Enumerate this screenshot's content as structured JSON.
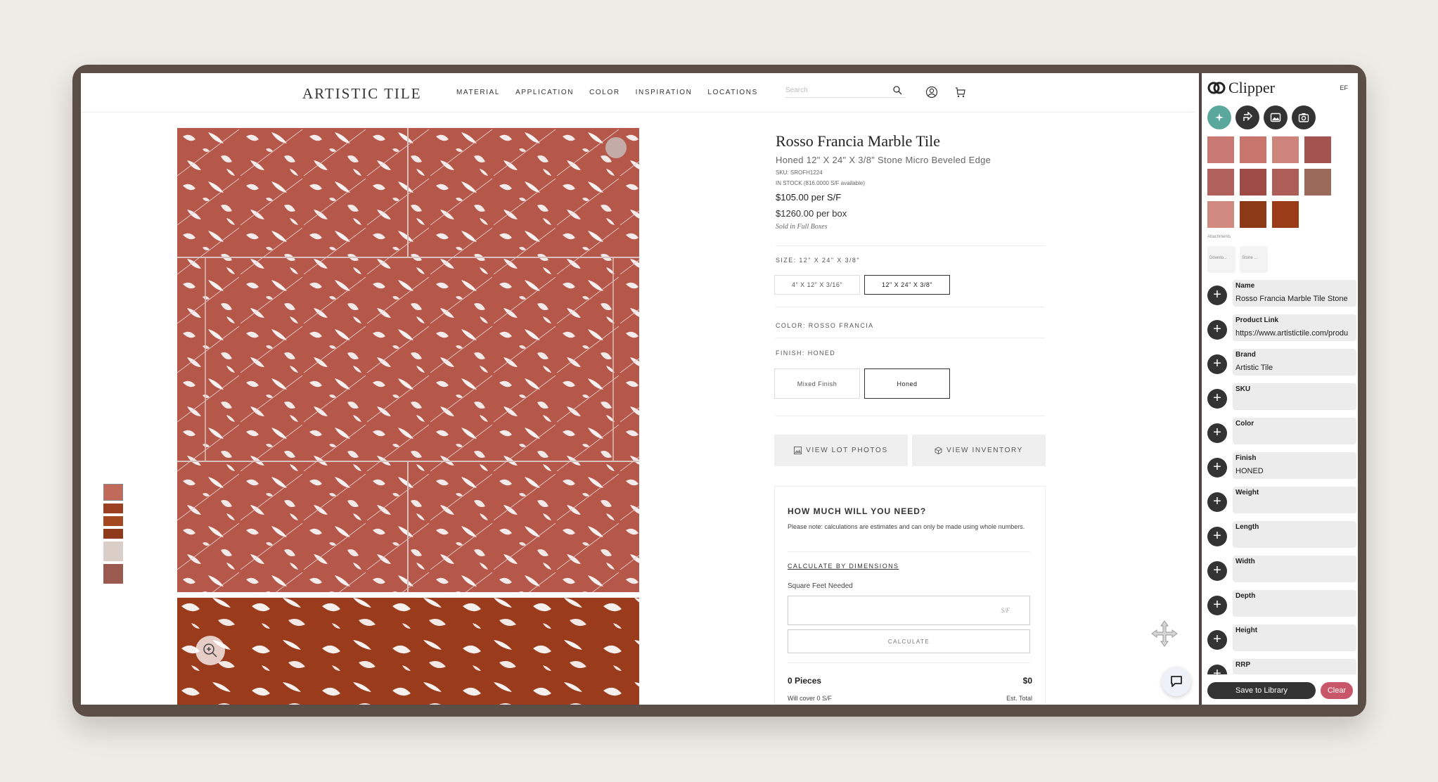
{
  "site": {
    "logo": "ARTISTIC TILE",
    "nav": [
      "MATERIAL",
      "APPLICATION",
      "COLOR",
      "INSPIRATION",
      "LOCATIONS"
    ],
    "search_placeholder": "Search"
  },
  "product": {
    "title": "Rosso Francia Marble Tile",
    "subtitle": "Honed 12\" X 24\" X 3/8\" Stone Micro Beveled Edge",
    "sku": "SKU: SROFH1224",
    "stock": "IN STOCK (816.0000 S/F available)",
    "price": "$105.00 per S/F",
    "box_price": "$1260.00 per box",
    "sold_note": "Sold in Full Boxes",
    "size_label": "SIZE: 12\" X 24\" X 3/8\"",
    "sizes": [
      {
        "label": "4\" X 12\" X 3/16\"",
        "selected": false
      },
      {
        "label": "12\" X 24\" X 3/8\"",
        "selected": true
      }
    ],
    "color_label": "COLOR: ROSSO FRANCIA",
    "finish_label": "FINISH: HONED",
    "finishes": [
      {
        "label": "Mixed Finish",
        "selected": false
      },
      {
        "label": "Honed",
        "selected": true
      }
    ],
    "lot_photos_btn": "VIEW LOT PHOTOS",
    "inventory_btn": "VIEW INVENTORY"
  },
  "calculator": {
    "heading": "HOW MUCH WILL YOU NEED?",
    "note": "Please note: calculations are estimates and can only be made using whole numbers.",
    "link": "CALCULATE BY DIMENSIONS",
    "sqft_label": "Square Feet Needed",
    "unit": "S/F",
    "calc_btn": "CALCULATE",
    "pieces": "0 Pieces",
    "total": "$0",
    "cover": "Will cover 0 S/F",
    "est": "Est. Total"
  },
  "clipper": {
    "brand": "Clipper",
    "user": "EF",
    "attachments_label": "Attachments",
    "attachments": [
      "Downlo...",
      "Stone ..."
    ],
    "fields": [
      {
        "label": "Name",
        "value": "Rosso Francia Marble Tile  Stone"
      },
      {
        "label": "Product Link",
        "value": "https://www.artistictile.com/produ"
      },
      {
        "label": "Brand",
        "value": "Artistic Tile"
      },
      {
        "label": "SKU",
        "value": ""
      },
      {
        "label": "Color",
        "value": ""
      },
      {
        "label": "Finish",
        "value": "HONED"
      },
      {
        "label": "Weight",
        "value": ""
      },
      {
        "label": "Length",
        "value": ""
      },
      {
        "label": "Width",
        "value": ""
      },
      {
        "label": "Depth",
        "value": ""
      },
      {
        "label": "Height",
        "value": ""
      },
      {
        "label": "RRP",
        "value": ""
      }
    ],
    "save_btn": "Save to Library",
    "clear_btn": "Clear"
  }
}
